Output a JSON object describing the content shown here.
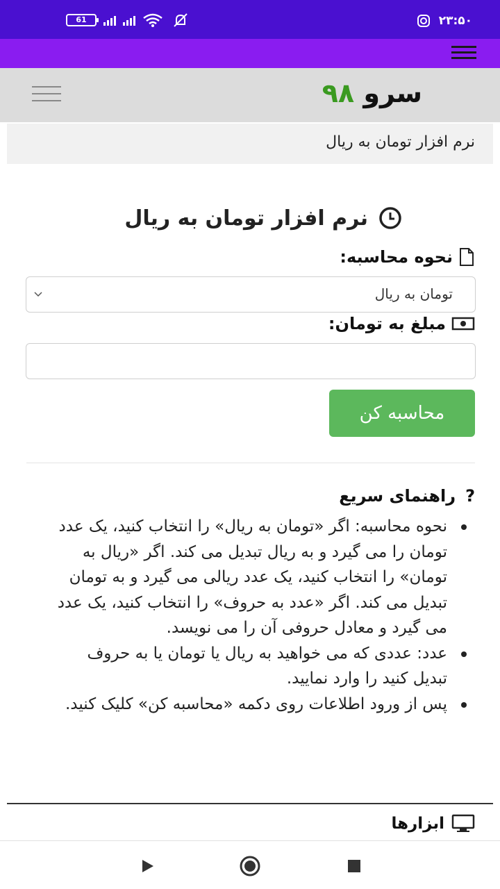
{
  "status_bar": {
    "battery": "61",
    "time": "۲۳:۵۰"
  },
  "site": {
    "logo_name": "سرو",
    "logo_number": "۹۸",
    "breadcrumb": "نرم افزار تومان به ریال"
  },
  "main": {
    "title": "نرم افزار تومان به ریال",
    "calc_mode_label": "نحوه محاسبه:",
    "calc_mode_selected": "تومان به ریال",
    "amount_label": "مبلغ به تومان:",
    "amount_value": "",
    "submit_label": "محاسبه کن"
  },
  "guide": {
    "title": "راهنمای سریع",
    "items": [
      "نحوه محاسبه: اگر «تومان به ریال» را انتخاب کنید، یک عدد تومان را می گیرد و به ریال تبدیل می کند. اگر «ریال به تومان» را انتخاب کنید، یک عدد ریالی می گیرد و به تومان تبدیل می کند. اگر «عدد به حروف» را انتخاب کنید، یک عدد می گیرد و معادل حروفی آن را می نویسد.",
      "عدد: عددی که می خواهید به ریال یا تومان یا به حروف تبدیل کنید را وارد نمایید.",
      "پس از ورود اطلاعات روی دکمه «محاسبه کن» کلیک کنید."
    ]
  },
  "tools": {
    "title": "ابزارها"
  },
  "colors": {
    "status_bar": "#4a10d0",
    "app_bar": "#8a1cf0",
    "logo_accent": "#3a9a20",
    "button": "#5cb85c"
  }
}
